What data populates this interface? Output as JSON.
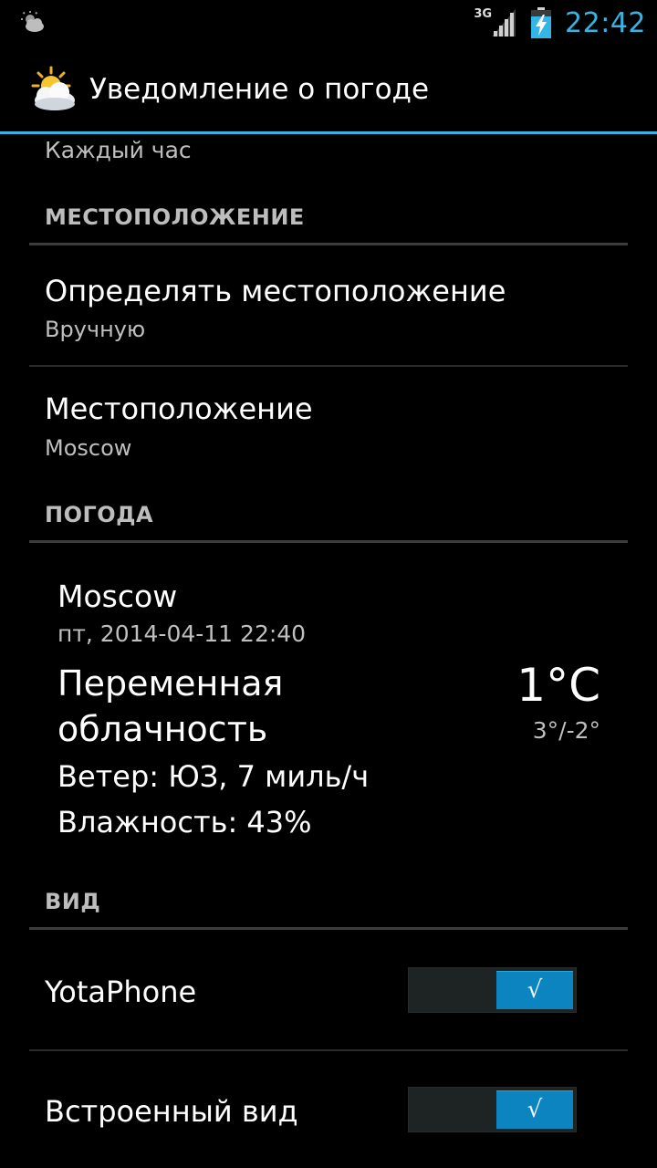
{
  "status_bar": {
    "network": "3G",
    "time": "22:42",
    "icons": [
      "weather-notification-icon",
      "signal-icon",
      "battery-charging-icon"
    ],
    "accent_color": "#33b5e5"
  },
  "action_bar": {
    "title": "Уведомление о погоде",
    "icon": "weather-app-icon"
  },
  "update_interval_summary": "Каждый час",
  "sections": {
    "location": {
      "header": "МЕСТОПОЛОЖЕНИЕ",
      "detect": {
        "title": "Определять местоположение",
        "summary": "Вручную"
      },
      "location": {
        "title": "Местоположение",
        "summary": "Moscow"
      }
    },
    "weather": {
      "header": "ПОГОДА",
      "city": "Moscow",
      "datetime": "пт, 2014-04-11 22:40",
      "condition": "Переменная облачность",
      "wind": "Ветер: ЮЗ, 7 миль/ч",
      "humidity": "Влажность: 43%",
      "temperature": "1°C",
      "range": "3°/-2°"
    },
    "view": {
      "header": "ВИД",
      "yotaphone": {
        "title": "YotaPhone",
        "enabled": true,
        "check": "√"
      },
      "builtin": {
        "title": "Встроенный вид",
        "enabled": true,
        "check": "√"
      }
    }
  }
}
